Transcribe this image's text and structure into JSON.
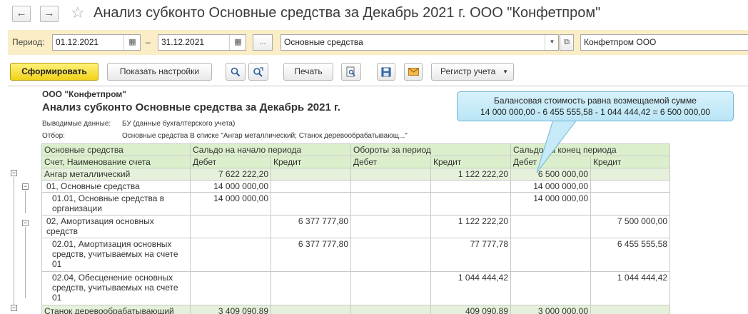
{
  "window": {
    "title": "Анализ субконто Основные средства за Декабрь 2021 г. ООО \"Конфетпром\""
  },
  "params": {
    "period_label": "Период:",
    "date_from": "01.12.2021",
    "dash": "–",
    "date_to": "31.12.2021",
    "ellipsis": "...",
    "subconto": "Основные средства",
    "org": "Конфетпром ООО"
  },
  "toolbar": {
    "generate": "Сформировать",
    "show_settings": "Показать настройки",
    "print": "Печать",
    "register": "Регистр учета"
  },
  "report": {
    "org_name": "ООО \"Конфетпром\"",
    "title": "Анализ субконто Основные средства за Декабрь 2021 г.",
    "output_label": "Выводимые данные:",
    "output_value": "БУ (данные бухгалтерского учета)",
    "filter_label": "Отбор:",
    "filter_value": "Основные средства В списке \"Ангар металлический; Станок деревообрабатывающ...\"",
    "columns": {
      "main": "Основные средства",
      "sub": "Счет, Наименование счета",
      "open": "Сальдо на начало периода",
      "turn": "Обороты за период",
      "close": "Сальдо на конец периода",
      "debit": "Дебет",
      "credit": "Кредит"
    },
    "rows": [
      {
        "name": "Ангар металлический",
        "od": "7 622 222,20",
        "oc": "",
        "td": "",
        "tc": "1 122 222,20",
        "cd": "6 500 000,00",
        "cc": ""
      },
      {
        "name": "01, Основные средства",
        "od": "14 000 000,00",
        "oc": "",
        "td": "",
        "tc": "",
        "cd": "14 000 000,00",
        "cc": ""
      },
      {
        "name": "01.01, Основные средства в организации",
        "od": "14 000 000,00",
        "oc": "",
        "td": "",
        "tc": "",
        "cd": "14 000 000,00",
        "cc": ""
      },
      {
        "name": "02, Амортизация основных средств",
        "od": "",
        "oc": "6 377 777,80",
        "td": "",
        "tc": "1 122 222,20",
        "cd": "",
        "cc": "7 500 000,00"
      },
      {
        "name": "02.01, Амортизация основных средств, учитываемых на счете 01",
        "od": "",
        "oc": "6 377 777,80",
        "td": "",
        "tc": "77 777,78",
        "cd": "",
        "cc": "6 455 555,58"
      },
      {
        "name": "02.04, Обесценение основных средств, учитываемых на счете 01",
        "od": "",
        "oc": "",
        "td": "",
        "tc": "1 044 444,42",
        "cd": "",
        "cc": "1 044 444,42"
      },
      {
        "name": "Станок деревообрабатывающий",
        "od": "3 409 090,89",
        "oc": "",
        "td": "",
        "tc": "409 090,89",
        "cd": "3 000 000,00",
        "cc": ""
      }
    ]
  },
  "callout": {
    "line1": "Балансовая стоимость равна возмещаемой сумме",
    "line2": "14 000 000,00 - 6 455 555,58 - 1 044 444,42 = 6 500 000,00"
  }
}
